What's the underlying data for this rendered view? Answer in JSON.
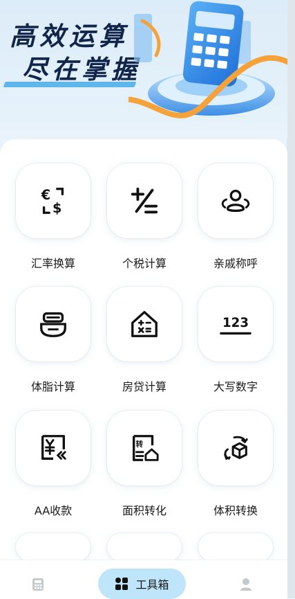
{
  "hero": {
    "line1": "高效运算",
    "line2": "尽在掌握"
  },
  "tools": [
    {
      "label": "汇率换算",
      "icon": "currency-exchange-icon"
    },
    {
      "label": "个税计算",
      "icon": "plus-minus-icon"
    },
    {
      "label": "亲戚称呼",
      "icon": "people-icon"
    },
    {
      "label": "体脂计算",
      "icon": "scale-icon"
    },
    {
      "label": "房贷计算",
      "icon": "house-calculator-icon"
    },
    {
      "label": "大写数字",
      "icon": "number-icon"
    },
    {
      "label": "AA收款",
      "icon": "yuan-receipt-icon"
    },
    {
      "label": "面积转化",
      "icon": "area-convert-icon"
    },
    {
      "label": "体积转换",
      "icon": "volume-convert-icon"
    }
  ],
  "number_icon_text": "123",
  "tabbar": {
    "calculator": "calculator-icon",
    "toolbox_label": "工具箱",
    "profile": "person-icon"
  },
  "colors": {
    "accent": "#5fb6ea",
    "tab_active_bg": "#bfe5fa",
    "title": "#11244a"
  }
}
